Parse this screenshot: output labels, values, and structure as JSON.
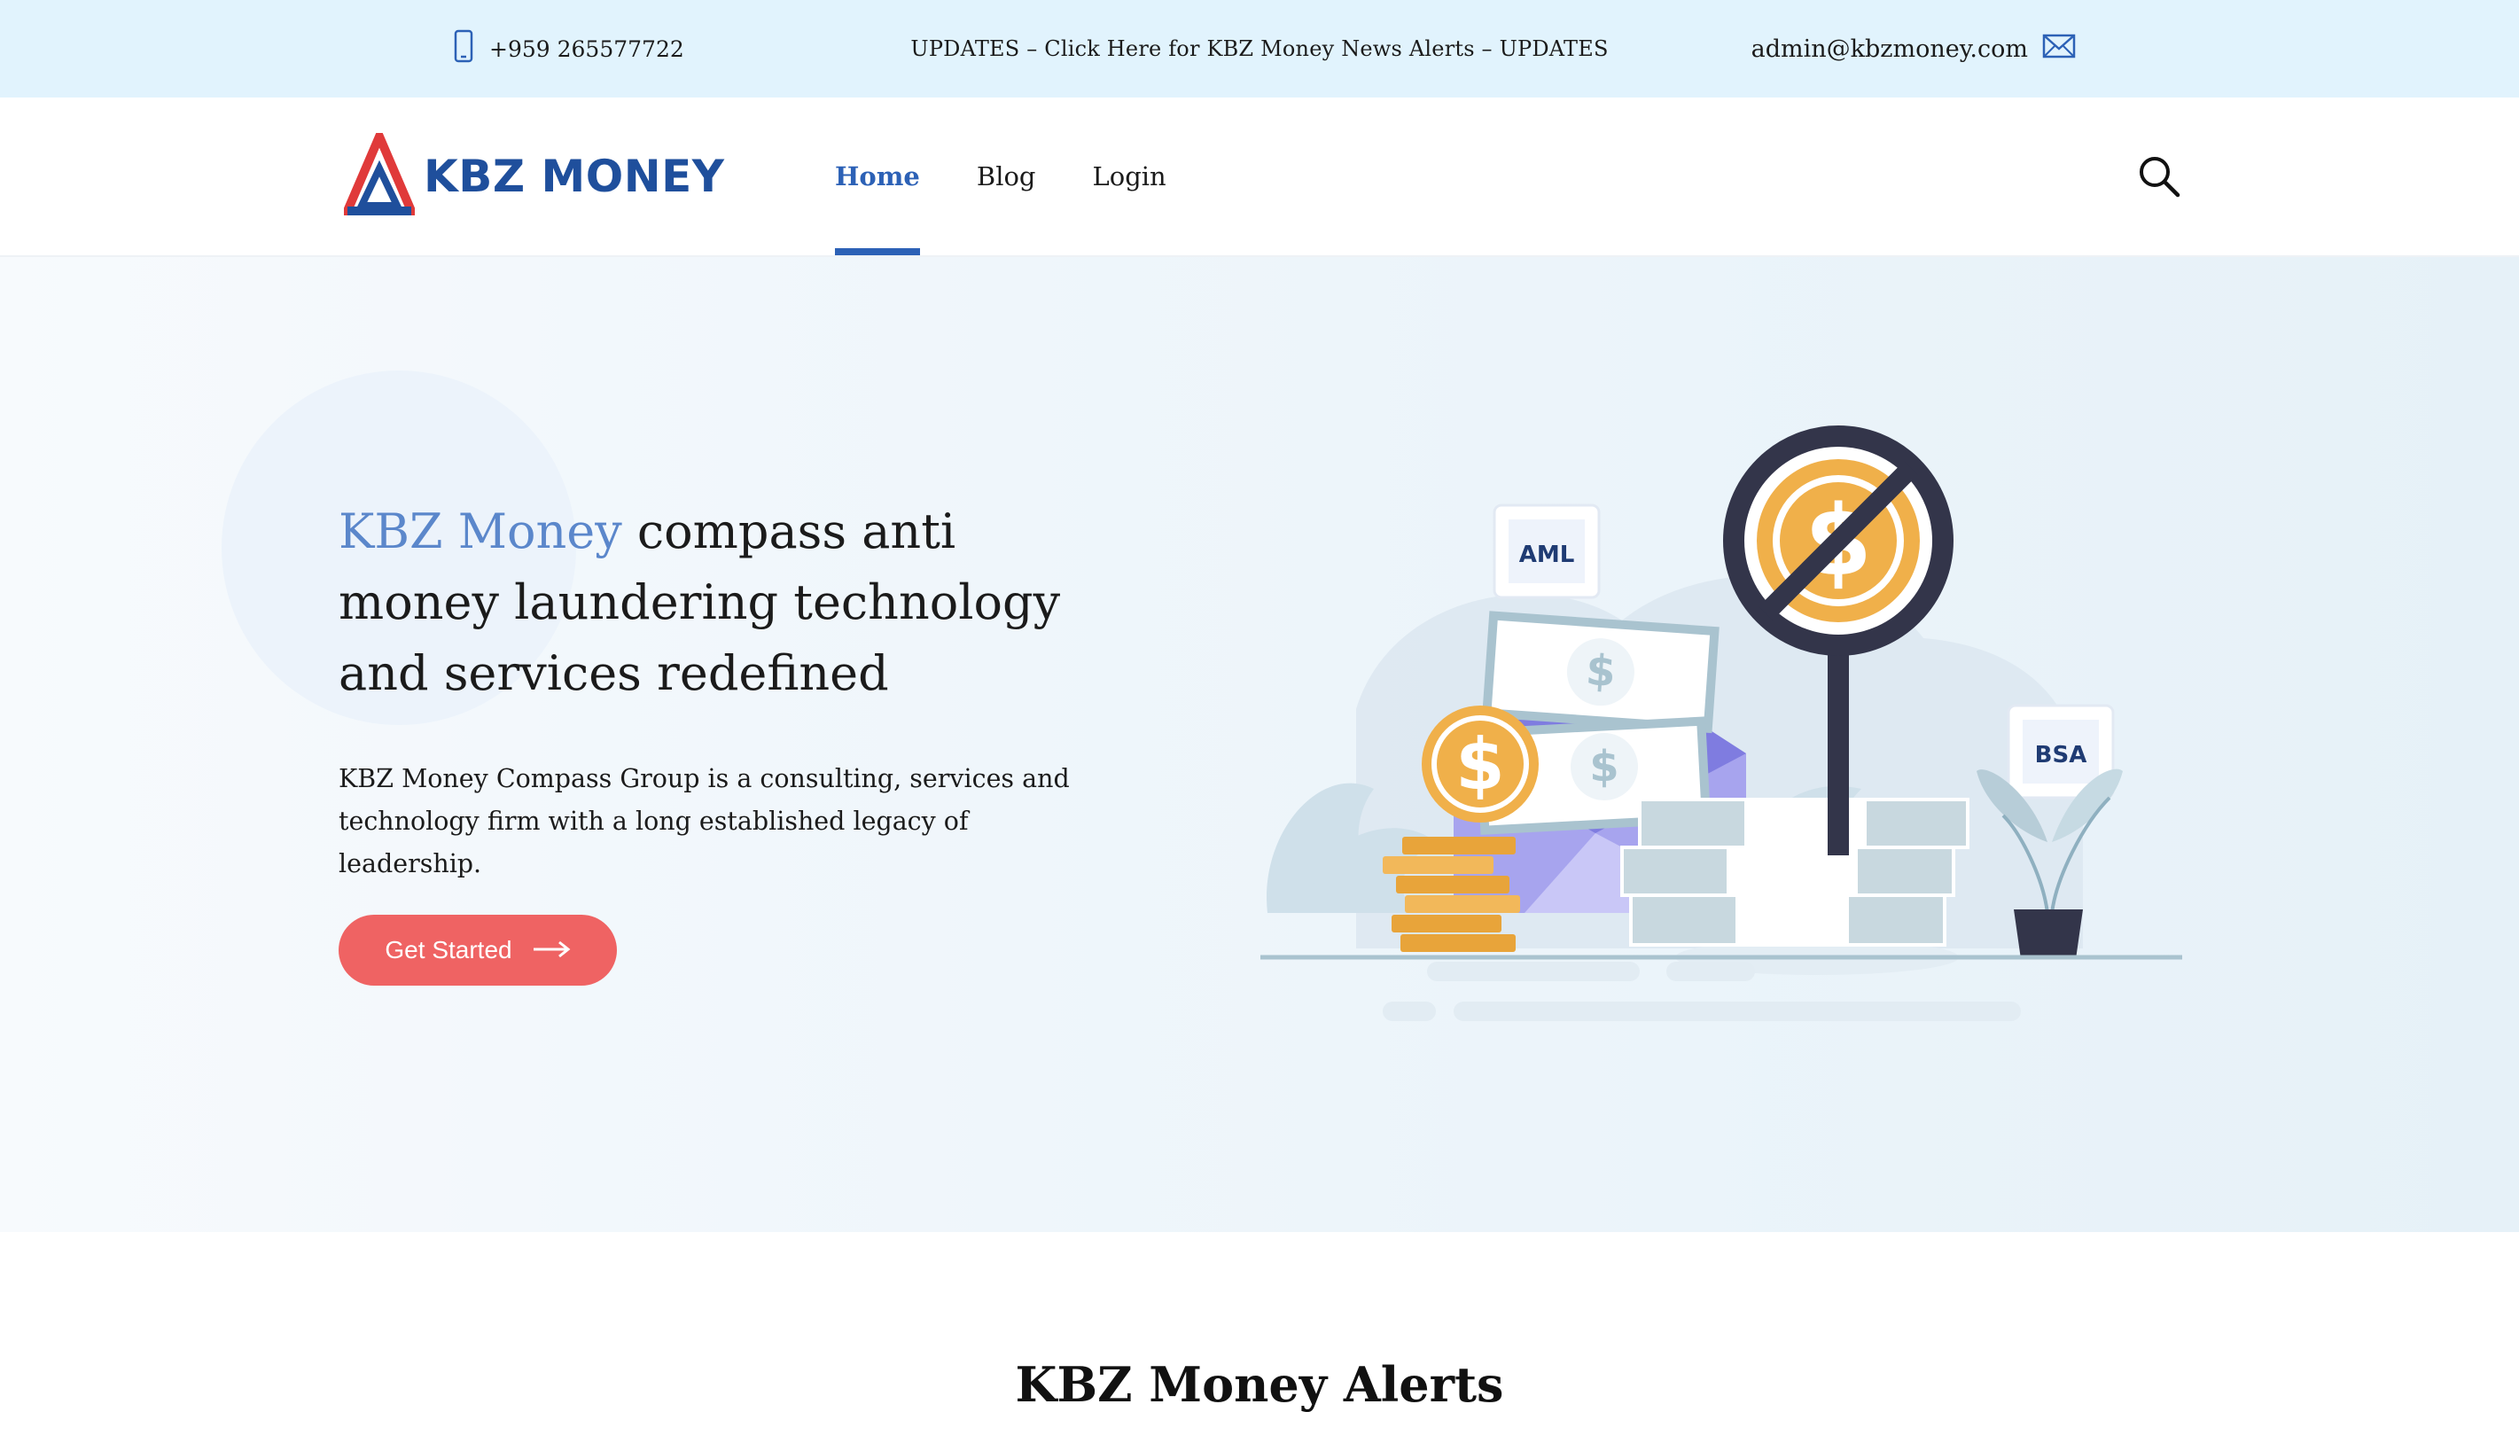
{
  "topbar": {
    "phone": "+959 265577722",
    "updates": "UPDATES – Click Here for KBZ Money News Alerts – UPDATES",
    "email": "admin@kbzmoney.com"
  },
  "header": {
    "logo_text": "KBZ MONEY",
    "nav": [
      {
        "label": "Home",
        "active": true
      },
      {
        "label": "Blog",
        "active": false
      },
      {
        "label": "Login",
        "active": false
      }
    ]
  },
  "hero": {
    "title_brand": "KBZ Money",
    "title_rest": " compass anti money laundering technology and services redefined",
    "description": "KBZ Money Compass Group is a consulting, services and technology firm with a long established legacy of leadership.",
    "cta_label": "Get Started",
    "illustration": {
      "badge_aml": "AML",
      "badge_bsa": "BSA"
    }
  },
  "section": {
    "title": "KBZ Money Alerts"
  },
  "colors": {
    "topbar_bg": "#e1f3fd",
    "accent_blue": "#2c61b6",
    "brand_light_blue": "#5b87cb",
    "cta_red": "#ef6363",
    "coin_gold": "#f0b04a"
  }
}
